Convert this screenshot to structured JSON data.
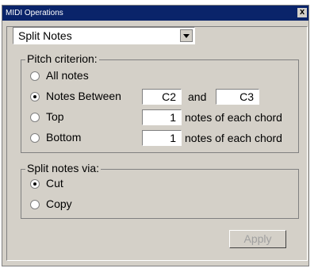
{
  "window": {
    "title": "MIDI Operations",
    "close_label": "x"
  },
  "operation": {
    "selected": "Split Notes"
  },
  "pitch": {
    "group_label": "Pitch criterion:",
    "options": [
      {
        "label": "All notes",
        "checked": false
      },
      {
        "label": "Notes Between",
        "checked": true
      },
      {
        "label": "Top",
        "checked": false
      },
      {
        "label": "Bottom",
        "checked": false
      }
    ],
    "between_low": "C2",
    "and_label": "and",
    "between_high": "C3",
    "top_count": "1",
    "bottom_count": "1",
    "per_chord_label": "notes of each chord"
  },
  "split": {
    "group_label": "Split notes via:",
    "options": [
      {
        "label": "Cut",
        "checked": true
      },
      {
        "label": "Copy",
        "checked": false
      }
    ]
  },
  "apply_label": "Apply"
}
